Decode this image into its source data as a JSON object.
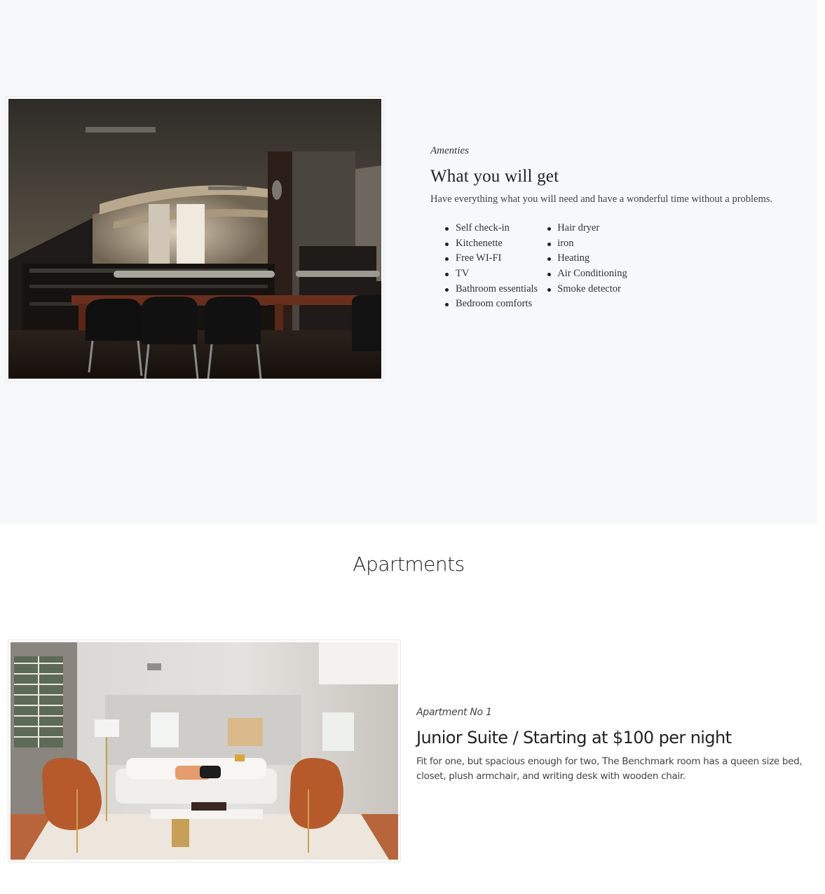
{
  "amenities": {
    "eyebrow": "Amenties",
    "title": "What you will get",
    "description": "Have everything what you will need and have a wonderful time without a problems.",
    "list_left": [
      "Self check-in",
      "Kitchenette",
      "Free WI-FI",
      "TV",
      "Bathroom essentials",
      "Bedroom comforts"
    ],
    "list_right": [
      "Hair dryer",
      "iron",
      "Heating",
      "Air Conditioning",
      "Smoke detector"
    ],
    "image_icon": "library-interior-photo"
  },
  "apartments": {
    "heading": "Apartments",
    "items": [
      {
        "eyebrow": "Apartment No 1",
        "title": "Junior Suite / Starting at $100 per night",
        "description": "Fit for one, but spacious enough for two, The Benchmark room has a queen size bed, closet, plush armchair, and writing desk with wooden chair.",
        "image_icon": "living-room-photo"
      }
    ]
  }
}
